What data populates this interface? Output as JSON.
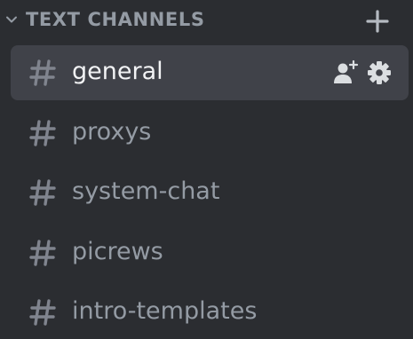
{
  "category": {
    "title": "TEXT CHANNELS",
    "collapse_icon": "chevron-down-icon",
    "add_icon": "plus-icon"
  },
  "channels": [
    {
      "name": "general",
      "selected": true,
      "actions": [
        "invite-icon",
        "gear-icon"
      ]
    },
    {
      "name": "proxys",
      "selected": false
    },
    {
      "name": "system-chat",
      "selected": false
    },
    {
      "name": "picrews",
      "selected": false
    },
    {
      "name": "intro-templates",
      "selected": false
    }
  ],
  "colors": {
    "background": "#2b2d31",
    "selected_background": "#404249",
    "muted_text": "#949ba4",
    "active_text": "#f2f3f5",
    "icon": "#b5bac1"
  }
}
